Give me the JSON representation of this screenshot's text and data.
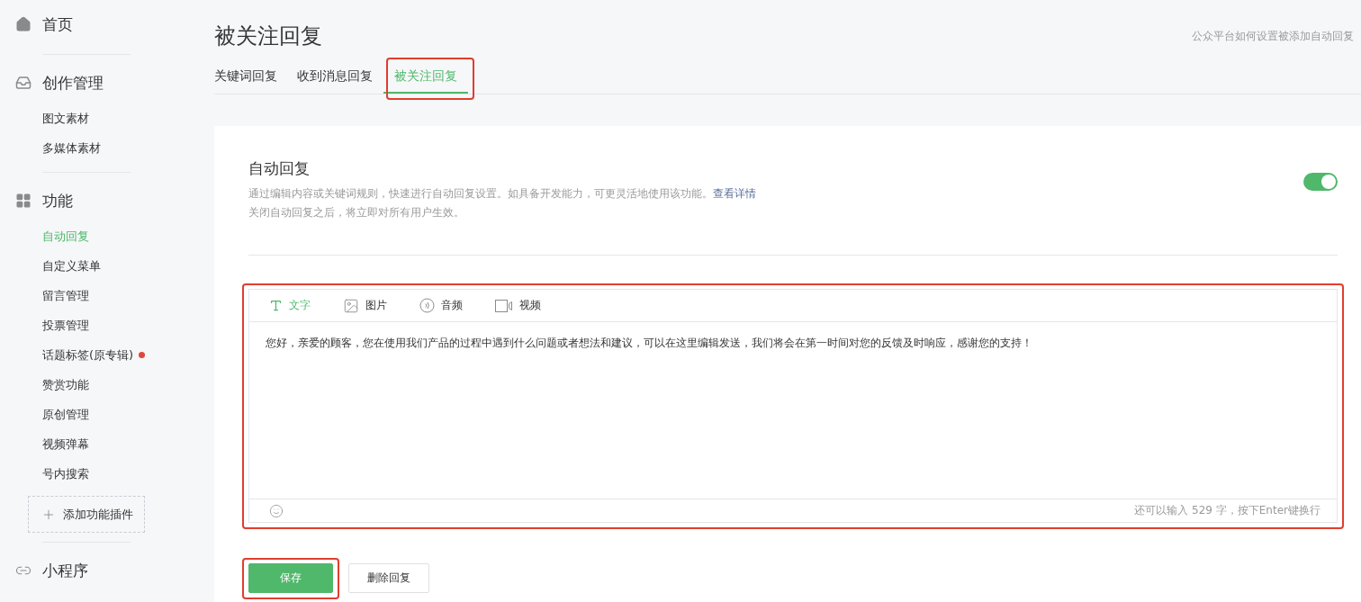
{
  "sidebar": {
    "sections": [
      {
        "kind": "home",
        "label": "首页"
      },
      {
        "kind": "inbox",
        "label": "创作管理",
        "items": [
          {
            "label": "图文素材",
            "selected": false
          },
          {
            "label": "多媒体素材",
            "selected": false
          }
        ]
      },
      {
        "kind": "grid",
        "label": "功能",
        "items": [
          {
            "label": "自动回复",
            "selected": true
          },
          {
            "label": "自定义菜单",
            "selected": false
          },
          {
            "label": "留言管理",
            "selected": false
          },
          {
            "label": "投票管理",
            "selected": false
          },
          {
            "label": "话题标签(原专辑)",
            "selected": false,
            "color": "#e0473d"
          },
          {
            "label": "赞赏功能",
            "selected": false
          },
          {
            "label": "原创管理",
            "selected": false
          },
          {
            "label": "视频弹幕",
            "selected": false
          },
          {
            "label": "号内搜索",
            "selected": false
          }
        ],
        "add_button": "添加功能插件"
      },
      {
        "kind": "link",
        "label": "小程序"
      }
    ]
  },
  "page": {
    "title": "被关注回复",
    "help_link": "公众平台如何设置被添加自动回复",
    "tabs": [
      {
        "label": "关键词回复",
        "selected": false,
        "highlighted": false
      },
      {
        "label": "收到消息回复",
        "selected": false,
        "highlighted": false
      },
      {
        "label": "被关注回复",
        "selected": true,
        "highlighted": true
      }
    ]
  },
  "card": {
    "title": "自动回复",
    "description": "通过编辑内容或关键词规则，快速进行自动回复设置。如具备开发能力，可更灵活地使用该功能。",
    "details_link": "查看详情",
    "note": "关闭自动回复之后，将立即对所有用户生效。",
    "toggle_on": true
  },
  "editor": {
    "highlighted": true,
    "media_tabs": [
      {
        "kind": "text",
        "label": "文字",
        "selected": true
      },
      {
        "kind": "image",
        "label": "图片",
        "selected": false
      },
      {
        "kind": "audio",
        "label": "音频",
        "selected": false
      },
      {
        "kind": "video",
        "label": "视频",
        "selected": false
      }
    ],
    "content": "您好，亲爱的顾客，您在使用我们产品的过程中遇到什么问题或者想法和建议，可以在这里编辑发送，我们将会在第一时间对您的反馈及时响应，感谢您的支持！",
    "counter": "还可以输入 529 字，按下Enter键换行"
  },
  "buttons": [
    {
      "kind": "primary",
      "label": "保存",
      "highlighted": true
    },
    {
      "kind": "default",
      "label": "删除回复",
      "highlighted": false
    }
  ]
}
